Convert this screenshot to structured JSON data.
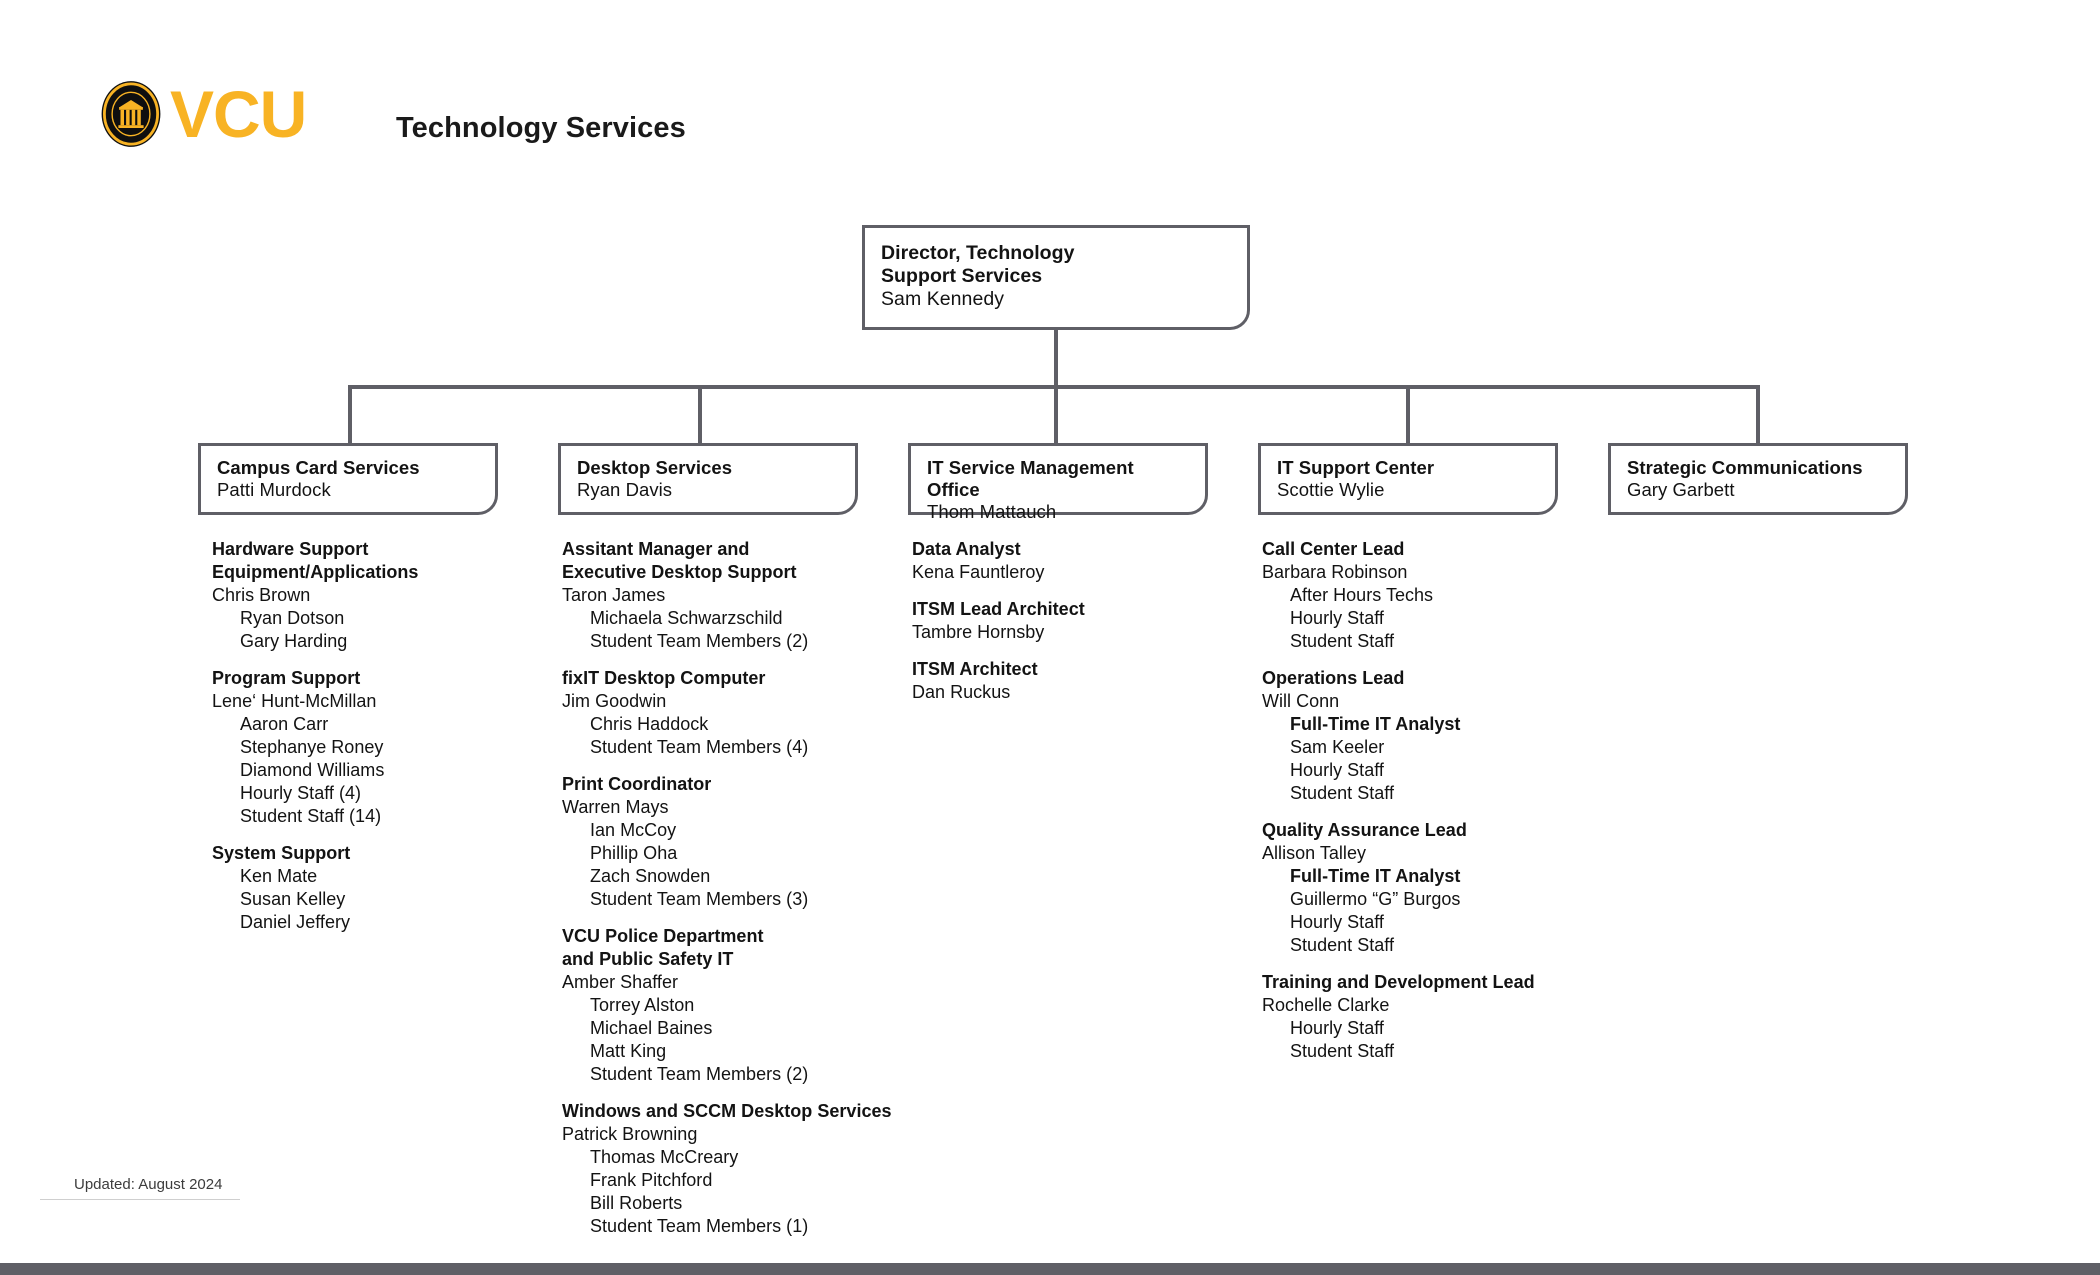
{
  "header": {
    "logo_text": "VCU",
    "seal_icon": "vcu-seal-icon",
    "title": "Technology Services",
    "brand_gold": "#F8B324",
    "line_gray": "#5f5f66"
  },
  "director": {
    "title": "Director, Technology\nSupport Services",
    "person": "Sam Kennedy"
  },
  "departments": [
    {
      "title": "Campus Card Services",
      "person": "Patti Murdock"
    },
    {
      "title": "Desktop Services",
      "person": "Ryan Davis"
    },
    {
      "title": "IT Service Management Office",
      "person": "Thom Mattauch"
    },
    {
      "title": "IT Support Center",
      "person": "Scottie Wylie"
    },
    {
      "title": "Strategic Communications",
      "person": "Gary Garbett"
    }
  ],
  "staff_columns": [
    {
      "department": "Campus Card Services",
      "groups": [
        {
          "heading": "Hardware Support\nEquipment/Applications",
          "lead": "Chris Brown",
          "members": [
            "Ryan Dotson",
            "Gary Harding"
          ]
        },
        {
          "heading": "Program Support",
          "lead": "Lene‘ Hunt-McMillan",
          "members": [
            "Aaron Carr",
            "Stephanye Roney",
            "Diamond Williams",
            "Hourly Staff (4)",
            "Student Staff (14)"
          ]
        },
        {
          "heading": "System Support",
          "lead": "",
          "members": [
            "Ken Mate",
            "Susan Kelley",
            "Daniel Jeffery"
          ]
        }
      ]
    },
    {
      "department": "Desktop Services",
      "groups": [
        {
          "heading": "Assitant Manager and\nExecutive Desktop Support",
          "lead": "Taron James",
          "members": [
            "Michaela Schwarzschild",
            "Student Team Members (2)"
          ]
        },
        {
          "heading": "fixIT Desktop Computer",
          "lead": "Jim Goodwin",
          "members": [
            "Chris Haddock",
            "Student Team Members (4)"
          ]
        },
        {
          "heading": "Print Coordinator",
          "lead": "Warren Mays",
          "members": [
            "Ian McCoy",
            "Phillip Oha",
            "Zach Snowden",
            "Student Team Members (3)"
          ]
        },
        {
          "heading": "VCU Police Department\nand Public Safety IT",
          "lead": "Amber Shaffer",
          "members": [
            "Torrey Alston",
            "Michael Baines",
            "Matt King",
            "Student Team Members (2)"
          ]
        },
        {
          "heading": "Windows and SCCM Desktop Services",
          "lead": "Patrick Browning",
          "members": [
            "Thomas McCreary",
            "Frank Pitchford",
            "Bill Roberts",
            "Student Team Members (1)"
          ]
        }
      ]
    },
    {
      "department": "IT Service Management Office",
      "groups": [
        {
          "heading": "Data Analyst",
          "lead": "Kena Fauntleroy",
          "members": []
        },
        {
          "heading": "ITSM Lead Architect",
          "lead": "Tambre Hornsby",
          "members": []
        },
        {
          "heading": "ITSM Architect",
          "lead": "Dan Ruckus",
          "members": []
        }
      ]
    },
    {
      "department": "IT Support Center",
      "groups": [
        {
          "heading": "Call Center Lead",
          "lead": "Barbara Robinson",
          "members": [
            "After Hours Techs",
            "Hourly Staff",
            "Student Staff"
          ]
        },
        {
          "heading": "Operations Lead",
          "lead": "Will Conn",
          "subheading": "Full-Time IT Analyst",
          "members": [
            "Sam Keeler",
            "Hourly Staff",
            "Student Staff"
          ]
        },
        {
          "heading": "Quality Assurance Lead",
          "lead": "Allison Talley",
          "subheading": "Full-Time IT Analyst",
          "members": [
            "Guillermo “G” Burgos",
            "Hourly Staff",
            "Student Staff"
          ]
        },
        {
          "heading": "Training and Development Lead",
          "lead": "Rochelle Clarke",
          "members": [
            "Hourly Staff",
            "Student Staff"
          ]
        }
      ]
    },
    {
      "department": "Strategic Communications",
      "groups": []
    }
  ],
  "footer": {
    "updated": "Updated: August 2024"
  }
}
